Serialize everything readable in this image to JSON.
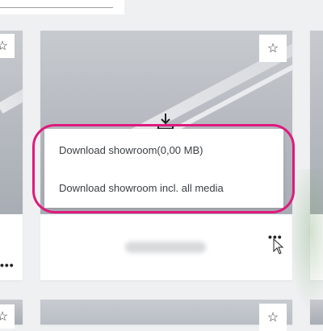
{
  "download_menu": {
    "items": [
      {
        "label": "Download showroom(0,00 MB)"
      },
      {
        "label": "Download showroom incl. all media"
      }
    ]
  },
  "card": {
    "more_label": "•••",
    "star_glyph": "☆"
  },
  "icons": {
    "star": "star-icon",
    "download": "download-icon",
    "more": "more-options-icon",
    "cursor": "mouse-pointer-icon"
  },
  "colors": {
    "highlight": "#e0197d",
    "page_background": "#eef0f1"
  }
}
